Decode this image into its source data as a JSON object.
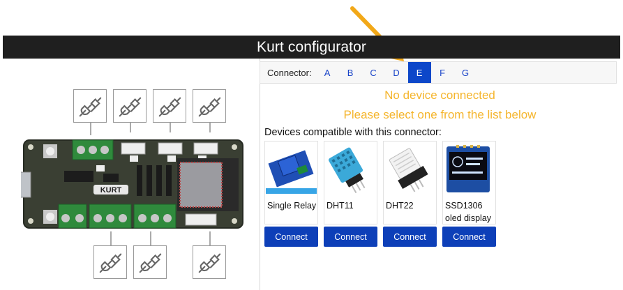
{
  "app": {
    "title": "Kurt configurator"
  },
  "connector_bar": {
    "label": "Connector:",
    "tabs": [
      "A",
      "B",
      "C",
      "D",
      "E",
      "F",
      "G"
    ],
    "active": "E"
  },
  "status": {
    "line1": "No device connected",
    "line2": "Please select one from the list below"
  },
  "devices_label": "Devices compatible with this connector:",
  "devices": [
    {
      "name": "Single Relay",
      "icon": "relay-module-image",
      "connect_label": "Connect"
    },
    {
      "name": "DHT11",
      "icon": "dht11-sensor-image",
      "connect_label": "Connect"
    },
    {
      "name": "DHT22",
      "icon": "dht22-sensor-image",
      "connect_label": "Connect"
    },
    {
      "name": "SSD1306 oled display",
      "icon": "oled-display-image",
      "connect_label": "Connect"
    }
  ],
  "board": {
    "logo_text": "KURT"
  },
  "colors": {
    "accent": "#0d47c9",
    "button": "#0d3fb8",
    "warning_text": "#f5b52c",
    "titlebar": "#1f1f1f",
    "arrow": "#f2a818",
    "pcb": "#3a3f33",
    "terminal": "#2f8a3c"
  }
}
